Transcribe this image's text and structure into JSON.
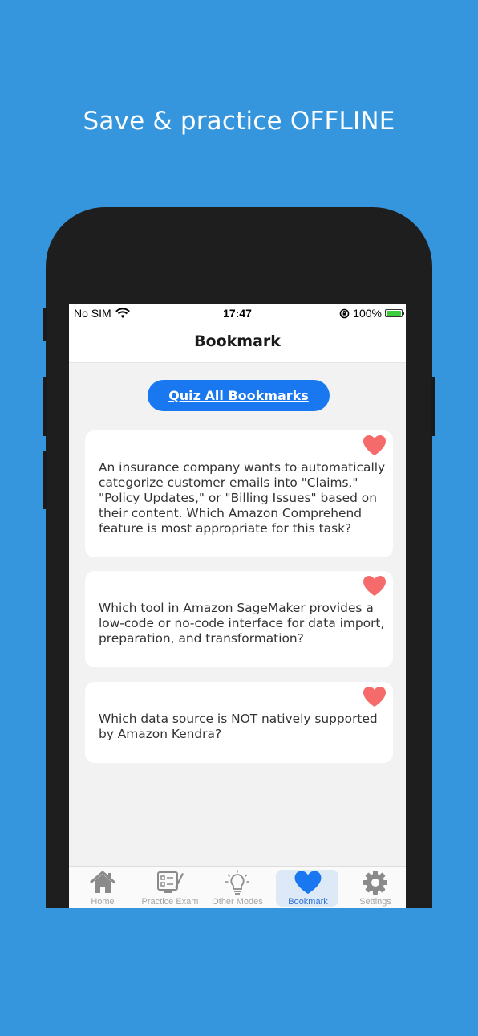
{
  "promo": {
    "headline": "Save & practice OFFLINE"
  },
  "status_bar": {
    "carrier": "No SIM",
    "time": "17:47",
    "battery": "100%"
  },
  "nav": {
    "title": "Bookmark"
  },
  "quiz_button": {
    "label": "Quiz All Bookmarks"
  },
  "bookmarks": [
    {
      "question": "An insurance company wants to automatically categorize customer emails into \"Claims,\" \"Policy Updates,\" or \"Billing Issues\" based on their content. Which Amazon Comprehend feature is most appropriate for this task?"
    },
    {
      "question": "Which tool in Amazon SageMaker provides a low-code or no-code interface for data import, preparation, and transformation?"
    },
    {
      "question": "Which data source is NOT natively supported by Amazon Kendra?"
    }
  ],
  "tabs": [
    {
      "label": "Home",
      "icon": "home-icon"
    },
    {
      "label": "Practice Exam",
      "icon": "exam-icon"
    },
    {
      "label": "Other Modes",
      "icon": "lightbulb-icon"
    },
    {
      "label": "Bookmark",
      "icon": "heart-icon",
      "active": true
    },
    {
      "label": "Settings",
      "icon": "gear-icon"
    }
  ],
  "colors": {
    "background": "#3596dd",
    "accent": "#1978f0",
    "heart": "#f56b6b",
    "active_tab": "#2a6fd6"
  }
}
